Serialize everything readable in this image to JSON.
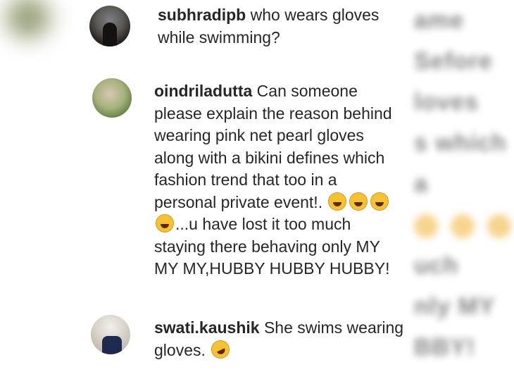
{
  "comments": [
    {
      "username": "subhradipb",
      "text_lines": [
        "who wears gloves",
        "while swimming?"
      ]
    },
    {
      "username": "oindriladutta",
      "text_lines": [
        "Can someone",
        "please explain the reason behind",
        "wearing pink net pearl gloves",
        "along with a bikini defines which",
        "fashion trend that too in a",
        "personal private event!.",
        "...u have lost it too much",
        "staying there behaving only MY",
        "MY MY,HUBBY HUBBY HUBBY!"
      ],
      "emoji": "face-with-tears-of-joy"
    },
    {
      "username": "swati.kaushik",
      "text_lines": [
        "She swims wearing",
        "gloves."
      ],
      "emoji": "rolling-on-floor-laughing"
    }
  ]
}
